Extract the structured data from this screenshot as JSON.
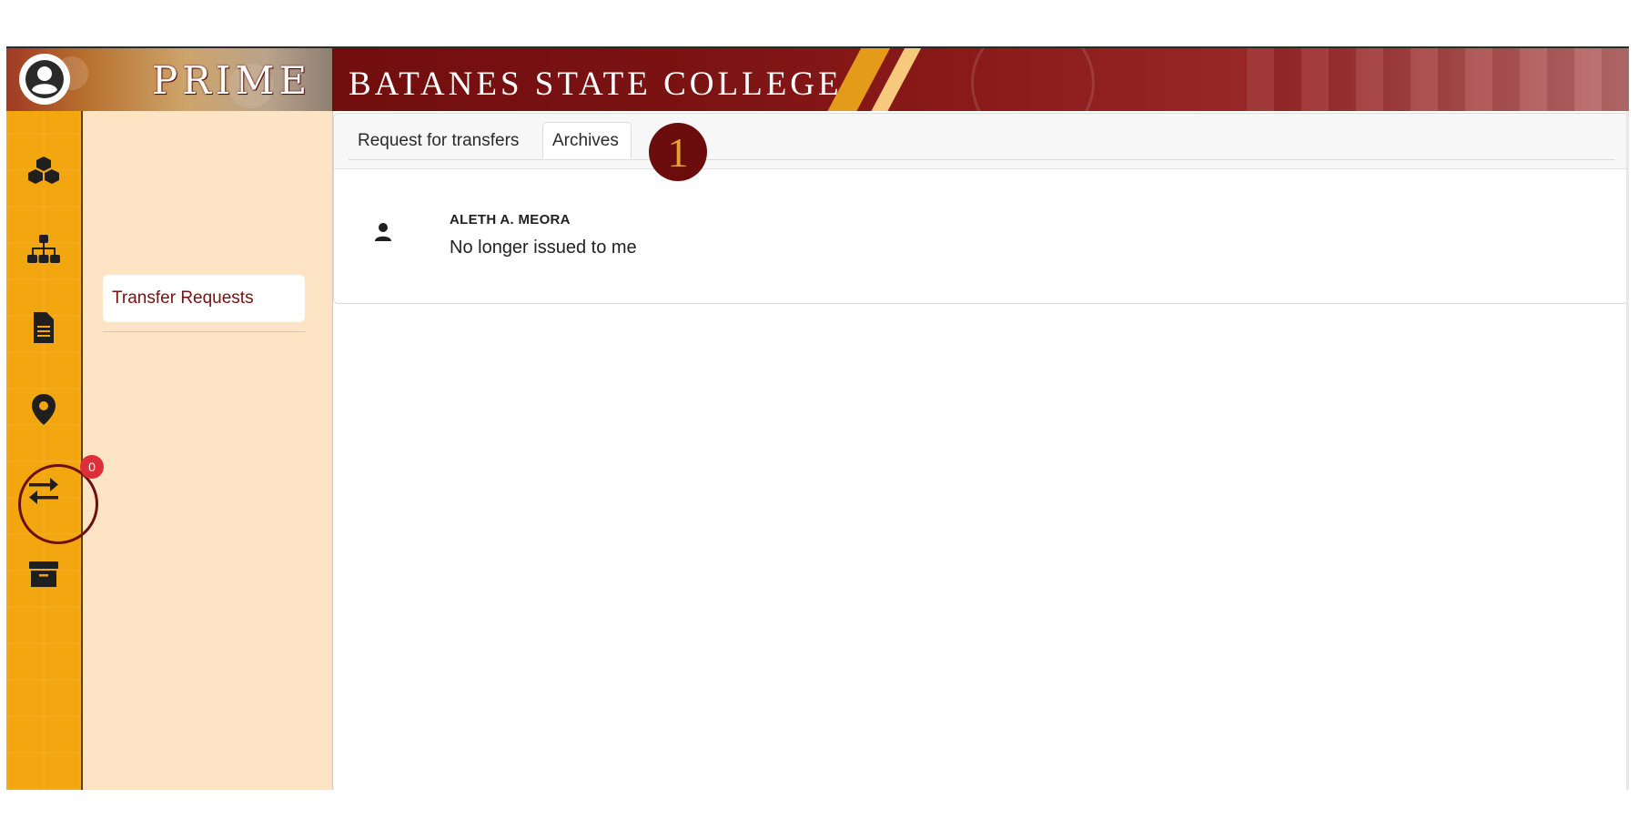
{
  "header": {
    "logo_text": "PRIME",
    "college_name": "BATANES STATE COLLEGE"
  },
  "rail": {
    "icons": [
      "cubes-icon",
      "sitemap-icon",
      "document-icon",
      "location-pin-icon",
      "transfer-arrows-icon",
      "archive-box-icon"
    ],
    "transfer_badge": "0"
  },
  "subnav": {
    "items": [
      {
        "label": "Transfer Requests"
      }
    ]
  },
  "tabs": [
    {
      "label": "Request for transfers"
    },
    {
      "label": "Archives"
    }
  ],
  "annotation": {
    "step": "1"
  },
  "archive_list": [
    {
      "name": "ALETH A. MEORA",
      "message": "No longer issued to me"
    }
  ],
  "colors": {
    "brand_maroon": "#6b0d0d",
    "rail_orange": "#f2a60f",
    "subnav_bg": "#fde4c4",
    "badge_red": "#dc2f3a"
  }
}
